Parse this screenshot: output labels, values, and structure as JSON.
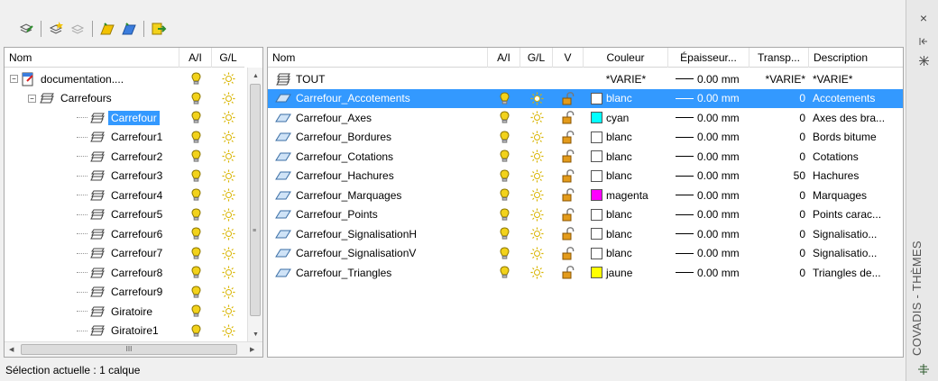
{
  "toolbar": {
    "buttons": [
      "layer-states-icon",
      "new-layer-icon",
      "delete-layer-icon",
      "new-group-icon",
      "new-filter-icon",
      "set-current-icon"
    ]
  },
  "tree": {
    "headers": {
      "name": "Nom",
      "ai": "A/I",
      "gl": "G/L"
    },
    "rows": [
      {
        "label": "documentation....",
        "level": 0,
        "toggle": "−",
        "selected": false
      },
      {
        "label": "Carrefours",
        "level": 1,
        "toggle": "−",
        "selected": false
      },
      {
        "label": "Carrefour",
        "level": 2,
        "toggle": "",
        "selected": true
      },
      {
        "label": "Carrefour1",
        "level": 2,
        "toggle": "",
        "selected": false
      },
      {
        "label": "Carrefour2",
        "level": 2,
        "toggle": "",
        "selected": false
      },
      {
        "label": "Carrefour3",
        "level": 2,
        "toggle": "",
        "selected": false
      },
      {
        "label": "Carrefour4",
        "level": 2,
        "toggle": "",
        "selected": false
      },
      {
        "label": "Carrefour5",
        "level": 2,
        "toggle": "",
        "selected": false
      },
      {
        "label": "Carrefour6",
        "level": 2,
        "toggle": "",
        "selected": false
      },
      {
        "label": "Carrefour7",
        "level": 2,
        "toggle": "",
        "selected": false
      },
      {
        "label": "Carrefour8",
        "level": 2,
        "toggle": "",
        "selected": false
      },
      {
        "label": "Carrefour9",
        "level": 2,
        "toggle": "",
        "selected": false
      },
      {
        "label": "Giratoire",
        "level": 2,
        "toggle": "",
        "selected": false
      },
      {
        "label": "Giratoire1",
        "level": 2,
        "toggle": "",
        "selected": false
      }
    ],
    "hscroll_label": "III"
  },
  "layers": {
    "headers": {
      "name": "Nom",
      "ai": "A/I",
      "gl": "G/L",
      "v": "V",
      "color": "Couleur",
      "thickness": "Épaisseur...",
      "transparency": "Transp...",
      "description": "Description"
    },
    "rows": [
      {
        "name": "TOUT",
        "color": "*VARIE*",
        "swatch": "",
        "thickness": "0.00 mm",
        "transparency": "*VARIE*",
        "description": "*VARIE*",
        "is_all": true,
        "selected": false
      },
      {
        "name": "Carrefour_Accotements",
        "color": "blanc",
        "swatch": "#ffffff",
        "thickness": "0.00 mm",
        "transparency": "0",
        "description": "Accotements",
        "is_all": false,
        "selected": true
      },
      {
        "name": "Carrefour_Axes",
        "color": "cyan",
        "swatch": "#00ffff",
        "thickness": "0.00 mm",
        "transparency": "0",
        "description": "Axes des bra...",
        "is_all": false,
        "selected": false
      },
      {
        "name": "Carrefour_Bordures",
        "color": "blanc",
        "swatch": "#ffffff",
        "thickness": "0.00 mm",
        "transparency": "0",
        "description": "Bords bitume",
        "is_all": false,
        "selected": false
      },
      {
        "name": "Carrefour_Cotations",
        "color": "blanc",
        "swatch": "#ffffff",
        "thickness": "0.00 mm",
        "transparency": "0",
        "description": "Cotations",
        "is_all": false,
        "selected": false
      },
      {
        "name": "Carrefour_Hachures",
        "color": "blanc",
        "swatch": "#ffffff",
        "thickness": "0.00 mm",
        "transparency": "50",
        "description": "Hachures",
        "is_all": false,
        "selected": false
      },
      {
        "name": "Carrefour_Marquages",
        "color": "magenta",
        "swatch": "#ff00ff",
        "thickness": "0.00 mm",
        "transparency": "0",
        "description": "Marquages",
        "is_all": false,
        "selected": false
      },
      {
        "name": "Carrefour_Points",
        "color": "blanc",
        "swatch": "#ffffff",
        "thickness": "0.00 mm",
        "transparency": "0",
        "description": "Points carac...",
        "is_all": false,
        "selected": false
      },
      {
        "name": "Carrefour_SignalisationH",
        "color": "blanc",
        "swatch": "#ffffff",
        "thickness": "0.00 mm",
        "transparency": "0",
        "description": "Signalisatio...",
        "is_all": false,
        "selected": false
      },
      {
        "name": "Carrefour_SignalisationV",
        "color": "blanc",
        "swatch": "#ffffff",
        "thickness": "0.00 mm",
        "transparency": "0",
        "description": "Signalisatio...",
        "is_all": false,
        "selected": false
      },
      {
        "name": "Carrefour_Triangles",
        "color": "jaune",
        "swatch": "#ffff00",
        "thickness": "0.00 mm",
        "transparency": "0",
        "description": "Triangles de...",
        "is_all": false,
        "selected": false
      }
    ]
  },
  "status": {
    "text": "Sélection actuelle : 1 calque"
  },
  "sidebar": {
    "title": "COVADIS - THÈMES",
    "close": "×",
    "icons": [
      "close-icon",
      "pin-icon",
      "properties-icon"
    ]
  },
  "colors": {
    "selection": "#3399ff",
    "bulb": "#f2d21b",
    "sun": "#d8b400",
    "lock": "#e39b1b"
  }
}
